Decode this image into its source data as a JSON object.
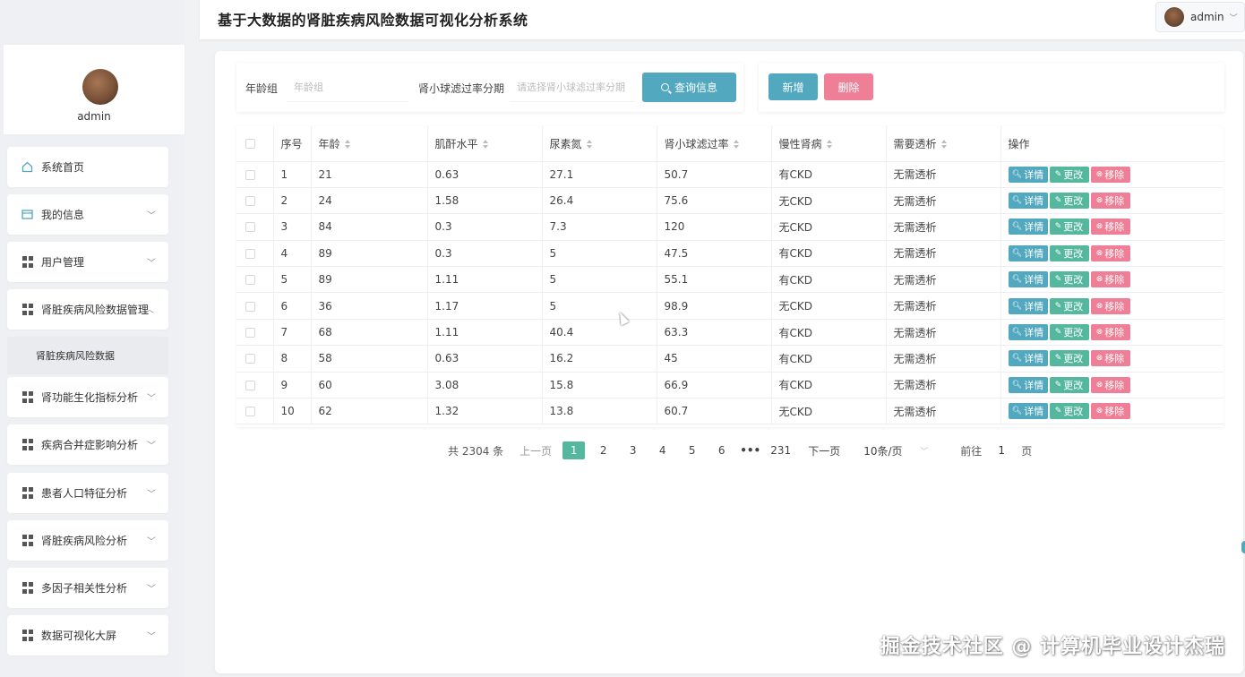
{
  "header": {
    "title": "基于大数据的肾脏疾病风险数据可视化分析系统",
    "username": "admin"
  },
  "profile": {
    "name": "admin"
  },
  "sidebar": {
    "items": [
      {
        "label": "系统首页",
        "icon": "home-icon"
      },
      {
        "label": "我的信息",
        "icon": "card-icon"
      },
      {
        "label": "用户管理",
        "icon": "grid-icon"
      },
      {
        "label": "肾脏疾病风险数据管理",
        "icon": "grid-icon"
      },
      {
        "label": "肾功能生化指标分析",
        "icon": "grid-icon"
      },
      {
        "label": "疾病合并症影响分析",
        "icon": "grid-icon"
      },
      {
        "label": "患者人口特征分析",
        "icon": "grid-icon"
      },
      {
        "label": "肾脏疾病风险分析",
        "icon": "grid-icon"
      },
      {
        "label": "多因子相关性分析",
        "icon": "grid-icon"
      },
      {
        "label": "数据可视化大屏",
        "icon": "grid-icon"
      }
    ],
    "submenu": "肾脏疾病风险数据"
  },
  "search": {
    "age_label": "年龄组",
    "age_placeholder": "年龄组",
    "gfr_label": "肾小球滤过率分期",
    "gfr_placeholder": "请选择肾小球滤过率分期",
    "query_label": "查询信息"
  },
  "actions": {
    "add_label": "新增",
    "delete_label": "删除"
  },
  "table": {
    "headers": [
      "序号",
      "年龄",
      "肌酐水平",
      "尿素氮",
      "肾小球滤过率",
      "慢性肾病",
      "需要透析",
      "操作"
    ],
    "rows": [
      [
        "1",
        "21",
        "0.63",
        "27.1",
        "50.7",
        "有CKD",
        "无需透析"
      ],
      [
        "2",
        "24",
        "1.58",
        "26.4",
        "75.6",
        "无CKD",
        "无需透析"
      ],
      [
        "3",
        "84",
        "0.3",
        "7.3",
        "120",
        "无CKD",
        "无需透析"
      ],
      [
        "4",
        "89",
        "0.3",
        "5",
        "47.5",
        "有CKD",
        "无需透析"
      ],
      [
        "5",
        "89",
        "1.11",
        "5",
        "55.1",
        "有CKD",
        "无需透析"
      ],
      [
        "6",
        "36",
        "1.17",
        "5",
        "98.9",
        "无CKD",
        "无需透析"
      ],
      [
        "7",
        "68",
        "1.11",
        "40.4",
        "63.3",
        "有CKD",
        "无需透析"
      ],
      [
        "8",
        "58",
        "0.63",
        "16.2",
        "45",
        "有CKD",
        "无需透析"
      ],
      [
        "9",
        "60",
        "3.08",
        "15.8",
        "66.9",
        "有CKD",
        "无需透析"
      ],
      [
        "10",
        "62",
        "1.32",
        "13.8",
        "60.7",
        "无CKD",
        "无需透析"
      ]
    ],
    "op_detail": "详情",
    "op_edit": "更改",
    "op_remove": "移除"
  },
  "pagination": {
    "total": "共 2304 条",
    "prev": "上一页",
    "pages": [
      "1",
      "2",
      "3",
      "4",
      "5",
      "6"
    ],
    "ellipsis": "•••",
    "last": "231",
    "next": "下一页",
    "page_size": "10条/页",
    "goto_prefix": "前往",
    "goto_value": "1",
    "goto_suffix": "页"
  },
  "watermark": "掘金技术社区 @ 计算机毕业设计杰瑞",
  "colors": {
    "primary": "#52a8bf",
    "success": "#55b89e",
    "danger": "#ee7f96"
  }
}
